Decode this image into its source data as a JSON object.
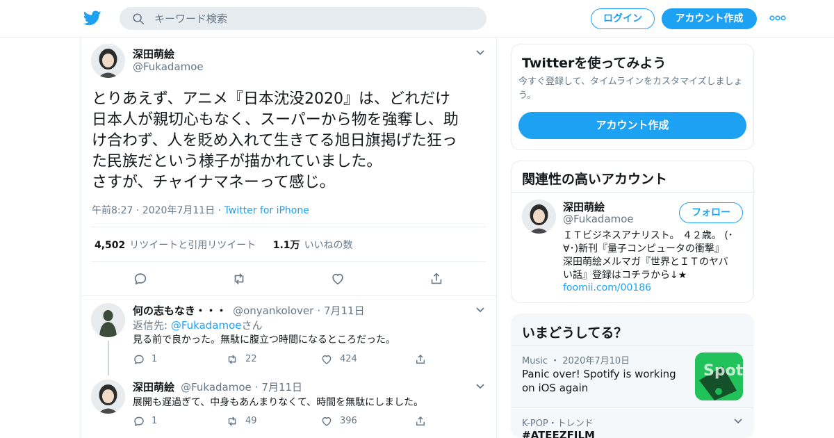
{
  "header": {
    "search_placeholder": "キーワード検索",
    "login_label": "ログイン",
    "signup_label": "アカウント作成"
  },
  "tweet": {
    "author_name": "深田萌絵",
    "author_handle": "@Fukadamoe",
    "text": "とりあえず、アニメ『日本沈没2020』は、どれだけ\n日本人が親切心もなく、スーパーから物を強奪し、助\nけ合わず、人を貶め入れて生きてる旭日旗掲げた狂っ\nた民族だという様子が描かれていました。\nさすが、チャイナマネーって感じ。",
    "time": "午前8:27",
    "date": "2020年7月11日",
    "source": "Twitter for iPhone",
    "retweets_count": "4,502",
    "retweets_label": "リツイートと引用リツイート",
    "likes_count": "1.1万",
    "likes_label": "いいねの数"
  },
  "replies": [
    {
      "name": "何の志もなき・・・",
      "handle": "@onyankolover",
      "date": "7月11日",
      "reply_to_prefix": "返信先: ",
      "reply_to_handle": "@Fukadamoe",
      "reply_to_suffix": "さん",
      "text": "見る前で良かった。無駄に腹立つ時間になるところだった。",
      "replies": "1",
      "retweets": "22",
      "likes": "424"
    },
    {
      "name": "深田萌絵",
      "handle": "@Fukadamoe",
      "date": "7月11日",
      "text": "展開も遅過ぎて、中身もあんまりなくて、時間を無駄にしました。",
      "replies": "1",
      "retweets": "49",
      "likes": "396"
    }
  ],
  "signup_card": {
    "title": "Twitterを使ってみよう",
    "subtitle": "今すぐ登録して、タイムラインをカスタマイズしましょう。",
    "button": "アカウント作成"
  },
  "related": {
    "title": "関連性の高いアカウント",
    "name": "深田萌絵",
    "handle": "@Fukadamoe",
    "follow_label": "フォロー",
    "bio": "ＩＴビジネスアナリスト。 ４２歳。 (･∀･)新刊『量子コンピュータの衝撃』 深田萌絵メルマガ『世界とＩＴのヤバい話』登録はコチラから↓★",
    "link": "foomii.com/00186"
  },
  "trends": {
    "title": "いまどうしてる？",
    "items": [
      {
        "meta": "Music ・ 2020年7月10日",
        "headline": "Panic over! Spotify is working on iOS again",
        "thumb_text": "Spot"
      },
      {
        "meta": "K-POP・トレンド",
        "headline": "#ATEEZFILM"
      }
    ]
  },
  "colors": {
    "accent": "#1da1f2",
    "secondary_text": "#657786",
    "border": "#e6ecf0"
  }
}
